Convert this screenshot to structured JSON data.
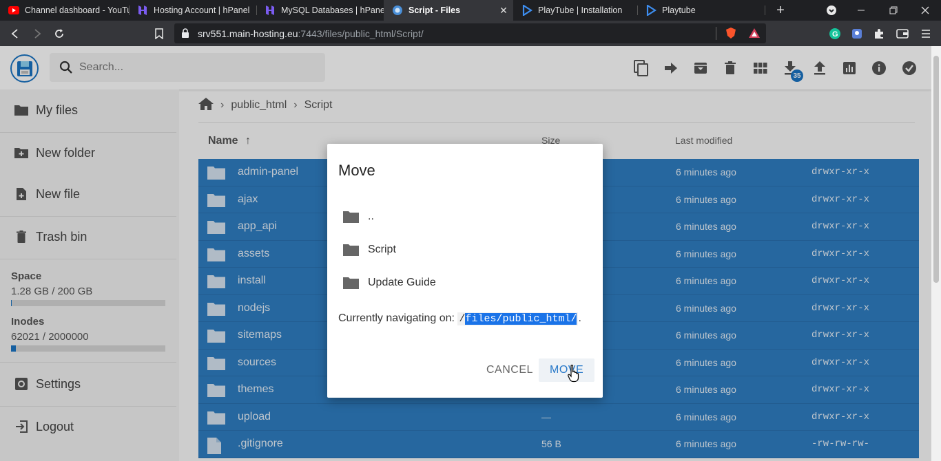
{
  "browser": {
    "tabs": [
      {
        "title": "Channel dashboard - YouTu",
        "icon": "youtube-icon",
        "active": false
      },
      {
        "title": "Hosting Account | hPanel",
        "icon": "hostinger-icon",
        "active": false
      },
      {
        "title": "MySQL Databases | hPanel",
        "icon": "hostinger-icon",
        "active": false
      },
      {
        "title": "Script - Files",
        "icon": "filebrowser-icon",
        "active": true
      },
      {
        "title": "PlayTube | Installation",
        "icon": "playtube-icon",
        "active": false
      },
      {
        "title": "Playtube",
        "icon": "playtube-icon",
        "active": false
      }
    ],
    "url_host": "srv551.main-hosting.eu",
    "url_rest": ":7443/files/public_html/Script/"
  },
  "app": {
    "search_placeholder": "Search...",
    "download_badge": "35"
  },
  "sidebar": {
    "items": [
      {
        "label": "My files",
        "icon": "folder-icon"
      },
      {
        "label": "New folder",
        "icon": "create-folder-icon"
      },
      {
        "label": "New file",
        "icon": "note-add-icon"
      },
      {
        "label": "Trash bin",
        "icon": "trash-icon"
      }
    ],
    "space_label": "Space",
    "space_value": "1.28 GB / 200 GB",
    "space_fraction": 0.0064,
    "inodes_label": "Inodes",
    "inodes_value": "62021 / 2000000",
    "inodes_fraction": 0.031,
    "settings_label": "Settings",
    "logout_label": "Logout"
  },
  "breadcrumb": [
    "public_html",
    "Script"
  ],
  "columns": {
    "name": "Name",
    "size": "Size",
    "modified": "Last modified"
  },
  "files": [
    {
      "name": "admin-panel",
      "type": "folder",
      "size": "",
      "modified": "6 minutes ago",
      "perm": "drwxr-xr-x"
    },
    {
      "name": "ajax",
      "type": "folder",
      "size": "",
      "modified": "6 minutes ago",
      "perm": "drwxr-xr-x"
    },
    {
      "name": "app_api",
      "type": "folder",
      "size": "",
      "modified": "6 minutes ago",
      "perm": "drwxr-xr-x"
    },
    {
      "name": "assets",
      "type": "folder",
      "size": "",
      "modified": "6 minutes ago",
      "perm": "drwxr-xr-x"
    },
    {
      "name": "install",
      "type": "folder",
      "size": "",
      "modified": "6 minutes ago",
      "perm": "drwxr-xr-x"
    },
    {
      "name": "nodejs",
      "type": "folder",
      "size": "",
      "modified": "6 minutes ago",
      "perm": "drwxr-xr-x"
    },
    {
      "name": "sitemaps",
      "type": "folder",
      "size": "",
      "modified": "6 minutes ago",
      "perm": "drwxr-xr-x"
    },
    {
      "name": "sources",
      "type": "folder",
      "size": "",
      "modified": "6 minutes ago",
      "perm": "drwxr-xr-x"
    },
    {
      "name": "themes",
      "type": "folder",
      "size": "",
      "modified": "6 minutes ago",
      "perm": "drwxr-xr-x"
    },
    {
      "name": "upload",
      "type": "folder",
      "size": "—",
      "modified": "6 minutes ago",
      "perm": "drwxr-xr-x"
    },
    {
      "name": ".gitignore",
      "type": "file",
      "size": "56 B",
      "modified": "6 minutes ago",
      "perm": "-rw-rw-rw-"
    }
  ],
  "modal": {
    "title": "Move",
    "items": [
      "..",
      "Script",
      "Update Guide"
    ],
    "nav_prefix": "Currently navigating on:",
    "nav_path_slash": "/",
    "nav_path_selected": "files/public_html/",
    "nav_suffix": ".",
    "cancel_label": "CANCEL",
    "move_label": "MOVE"
  }
}
